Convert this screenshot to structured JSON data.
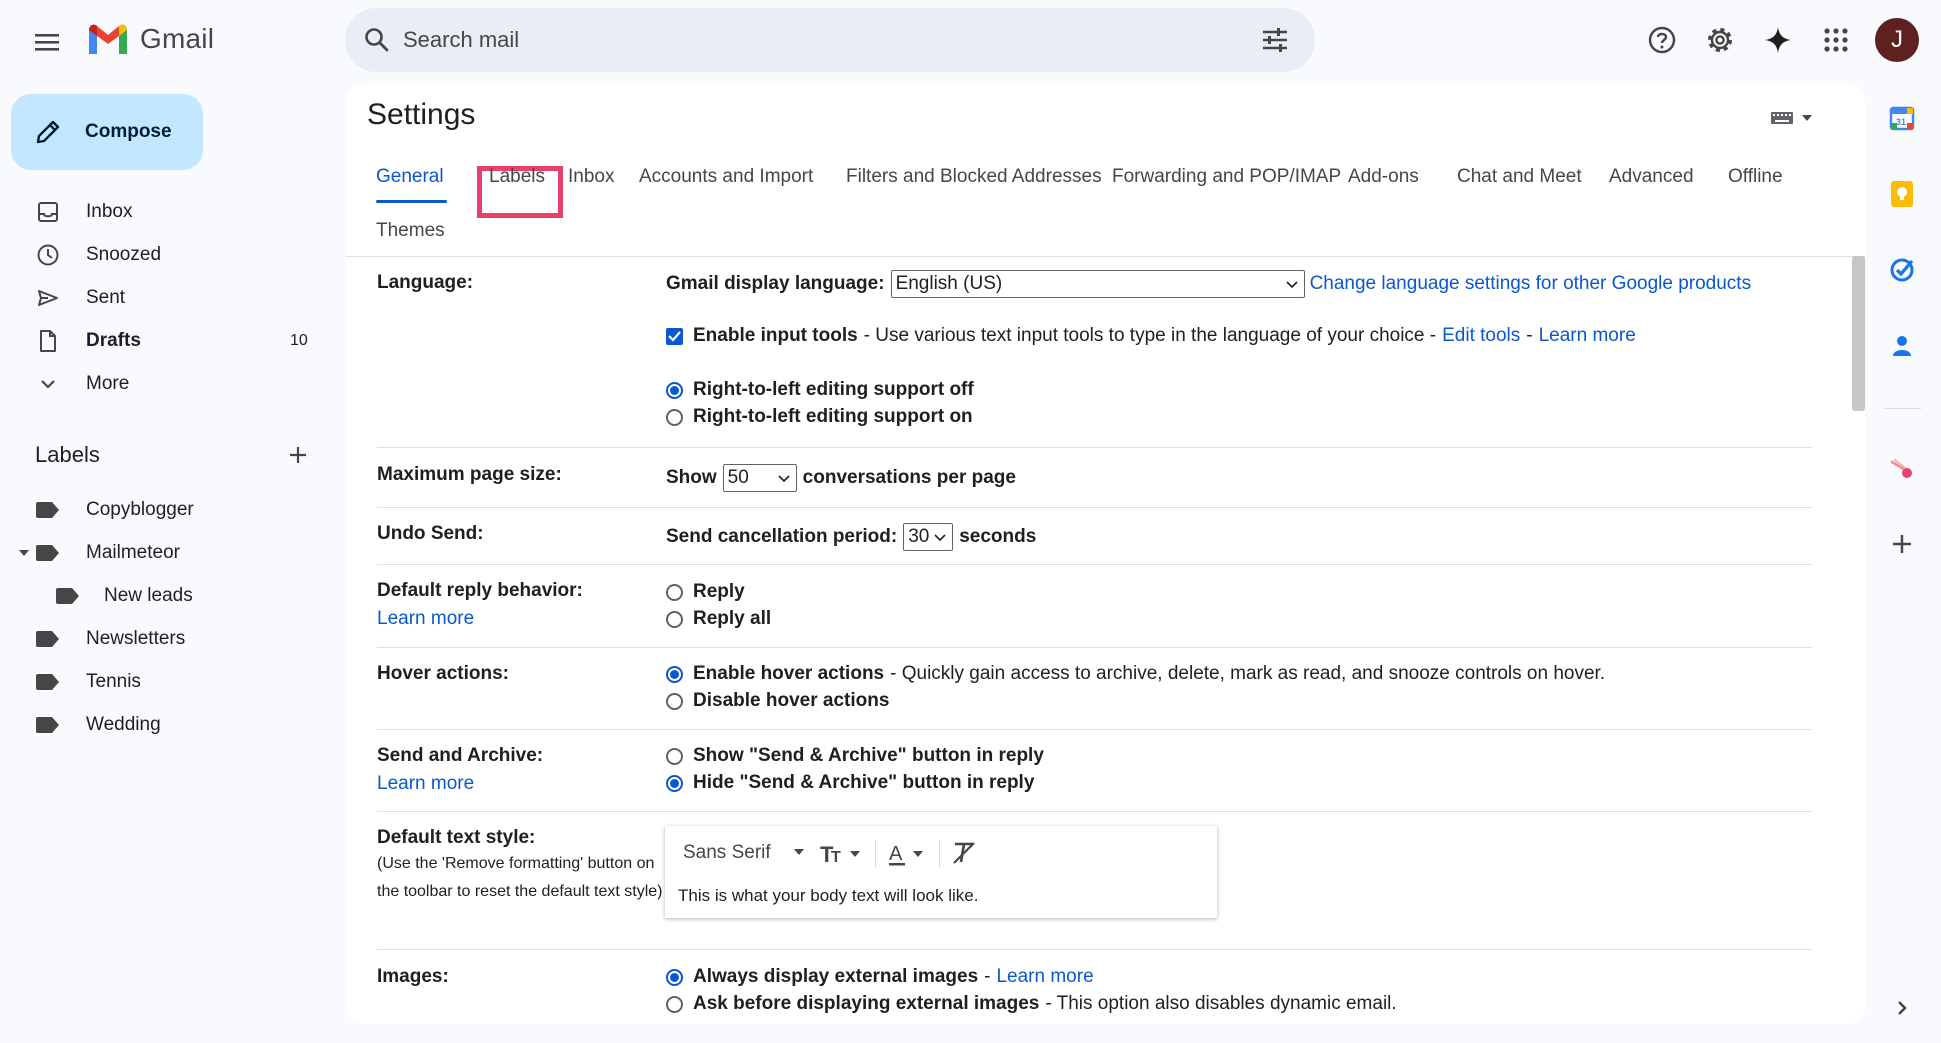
{
  "app": {
    "name": "Gmail"
  },
  "search": {
    "placeholder": "Search mail"
  },
  "account": {
    "avatar_initial": "J"
  },
  "colors": {
    "accent": "#0b57d0",
    "compose_bg": "#c2e7ff",
    "highlight": "#e8426c"
  },
  "nav": {
    "compose_label": "Compose",
    "items": [
      {
        "label": "Inbox",
        "icon": "inbox-icon",
        "count": ""
      },
      {
        "label": "Snoozed",
        "icon": "clock-icon",
        "count": ""
      },
      {
        "label": "Sent",
        "icon": "send-icon",
        "count": ""
      },
      {
        "label": "Drafts",
        "icon": "draft-icon",
        "count": "10"
      },
      {
        "label": "More",
        "icon": "chevron-down-icon",
        "count": ""
      }
    ]
  },
  "labels": {
    "title": "Labels",
    "items": [
      {
        "label": "Copyblogger"
      },
      {
        "label": "Mailmeteor"
      },
      {
        "label": "New leads"
      },
      {
        "label": "Newsletters"
      },
      {
        "label": "Tennis"
      },
      {
        "label": "Wedding"
      }
    ]
  },
  "settings": {
    "title": "Settings",
    "tabs": [
      "General",
      "Labels",
      "Inbox",
      "Accounts and Import",
      "Filters and Blocked Addresses",
      "Forwarding and POP/IMAP",
      "Add-ons",
      "Chat and Meet",
      "Advanced",
      "Offline",
      "Themes"
    ],
    "active_tab": "General",
    "language": {
      "label": "Language:",
      "display_label": "Gmail display language:",
      "display_value": "English (US)",
      "change_link": "Change language settings for other Google products",
      "input_tools_bold": "Enable input tools",
      "input_tools_desc": "- Use various text input tools to type in the language of your choice -",
      "edit_tools": "Edit tools",
      "dash": "-",
      "learn_more": "Learn more",
      "rtl_off": "Right-to-left editing support off",
      "rtl_on": "Right-to-left editing support on"
    },
    "page_size": {
      "label": "Maximum page size:",
      "show": "Show",
      "value": "50",
      "suffix": "conversations per page"
    },
    "undo_send": {
      "label": "Undo Send:",
      "prefix": "Send cancellation period:",
      "value": "30",
      "suffix": "seconds"
    },
    "reply": {
      "label": "Default reply behavior:",
      "learn_more": "Learn more",
      "opt1": "Reply",
      "opt2": "Reply all"
    },
    "hover": {
      "label": "Hover actions:",
      "opt1_bold": "Enable hover actions",
      "opt1_desc": "- Quickly gain access to archive, delete, mark as read, and snooze controls on hover.",
      "opt2": "Disable hover actions"
    },
    "send_archive": {
      "label": "Send and Archive:",
      "learn_more": "Learn more",
      "opt1": "Show \"Send & Archive\" button in reply",
      "opt2": "Hide \"Send & Archive\" button in reply"
    },
    "text_style": {
      "label": "Default text style:",
      "note": "(Use the 'Remove formatting' button on the toolbar to reset the default text style)",
      "font": "Sans Serif",
      "sample": "This is what your body text will look like."
    },
    "images": {
      "label": "Images:",
      "opt1_bold": "Always display external images",
      "opt1_dash": "-",
      "learn_more": "Learn more",
      "opt2_bold": "Ask before displaying external images",
      "opt2_desc": "- This option also disables dynamic email."
    }
  }
}
